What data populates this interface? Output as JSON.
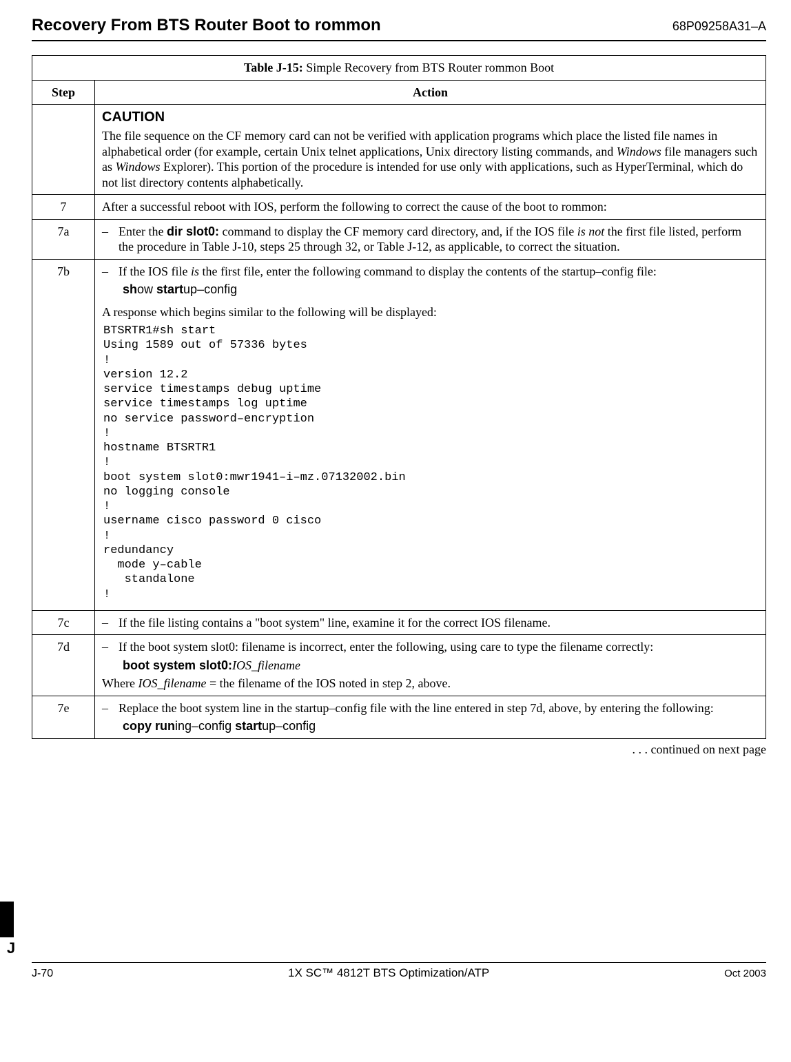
{
  "header": {
    "title": "Recovery From BTS Router Boot to rommon",
    "doc_id": "68P09258A31–A"
  },
  "table": {
    "caption_label": "Table J-15:",
    "caption_text": " Simple Recovery from BTS Router rommon Boot",
    "col_step": "Step",
    "col_action": "Action"
  },
  "caution": {
    "heading": "CAUTION",
    "body_part1": "The file sequence on the CF memory card can not be verified with application programs which place the listed file names in alphabetical order (for example, certain Unix telnet applications, Unix directory listing commands, and ",
    "body_italic1": "Windows",
    "body_part2": " file managers such as ",
    "body_italic2": "Windows",
    "body_part3": " Explorer). This portion of the procedure is intended for use only with applications, such as HyperTerminal, which do not list directory contents alphabetically."
  },
  "steps": {
    "s7": {
      "num": "7",
      "text": "After a successful reboot with IOS, perform the following to correct the cause of the boot to rommon:"
    },
    "s7a": {
      "num": "7a",
      "text_part1": "Enter the  ",
      "cmd": "dir  slot0:",
      "text_part2": "  command to display the CF memory card directory, and, if the IOS file ",
      "italic1": "is not",
      "text_part3": " the first file listed, perform the procedure in Table J-10, steps 25 through 32, or Table J-12, as applicable, to correct the situation."
    },
    "s7b": {
      "num": "7b",
      "text_part1": "If the IOS file ",
      "italic1": "is",
      "text_part2": " the first file, enter the following command to display the contents of the startup–config file:",
      "cmd_b1": "sh",
      "cmd_r1": "ow  ",
      "cmd_b2": "start",
      "cmd_r2": "up–config",
      "follow": "A response which begins similar to the following will be displayed:",
      "terminal": "BTSRTR1#sh start\nUsing 1589 out of 57336 bytes\n!\nversion 12.2\nservice timestamps debug uptime\nservice timestamps log uptime\nno service password–encryption\n!\nhostname BTSRTR1\n!\nboot system slot0:mwr1941–i–mz.07132002.bin\nno logging console\n!\nusername cisco password 0 cisco\n!\nredundancy\n  mode y–cable\n   standalone\n!"
    },
    "s7c": {
      "num": "7c",
      "text": "If the file listing contains a \"boot system\" line, examine it for the correct IOS filename."
    },
    "s7d": {
      "num": "7d",
      "text": "If the boot system slot0: filename is incorrect, enter the following, using care to type the filename correctly:",
      "cmd_bold": "boot system slot0:",
      "cmd_italic": "IOS_filename",
      "where_part1": "Where ",
      "where_italic": "IOS_filename ",
      "where_part2": " =  the filename of the IOS noted in step 2, above."
    },
    "s7e": {
      "num": "7e",
      "text": "Replace the boot system line in the startup–config file with the line entered in step 7d, above, by entering the following:",
      "cmd_b1": "copy  run",
      "cmd_r1": "ing–config  ",
      "cmd_b2": "start",
      "cmd_r2": "up–config"
    }
  },
  "continued": ". . . continued on next page",
  "footer": {
    "tab_letter": "J",
    "page": "J-70",
    "center": "1X SC™ 4812T BTS Optimization/ATP",
    "date": "Oct 2003"
  }
}
